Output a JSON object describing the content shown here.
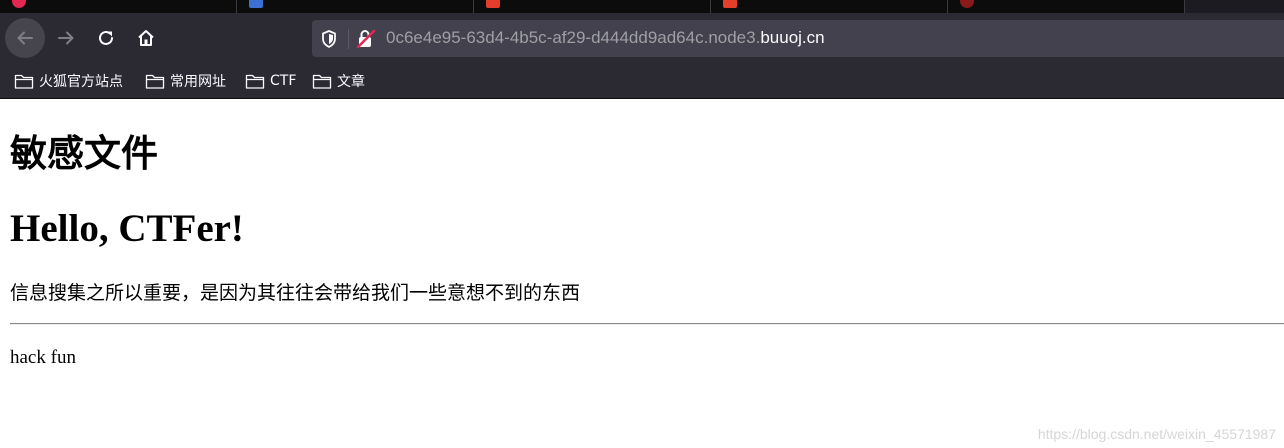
{
  "browser": {
    "tabs": [
      {
        "favicon_color": "#e22850"
      },
      {
        "favicon_color": "#3b6fd4"
      },
      {
        "favicon_color": "#e33d2b"
      },
      {
        "favicon_color": "#e33d2b"
      },
      {
        "favicon_color": "#8a1a1a"
      }
    ],
    "url": {
      "subdomain": "0c6e4e95-63d4-4b5c-af29-d444dd9ad64c.node3.",
      "domain": "buuoj.cn"
    },
    "bookmarks": [
      "火狐官方站点",
      "常用网址",
      "CTF",
      "文章"
    ]
  },
  "page": {
    "heading_cn": "敏感文件",
    "heading_en": "Hello, CTFer!",
    "paragraph": "信息搜集之所以重要，是因为其往往会带给我们一些意想不到的东西",
    "footer_text": "hack fun"
  },
  "watermark": "https://blog.csdn.net/weixin_45571987",
  "colors": {
    "toolbar_bg": "#2b2a33",
    "urlbar_bg": "#42414d",
    "tabstrip_bg": "#0c0c0d"
  }
}
